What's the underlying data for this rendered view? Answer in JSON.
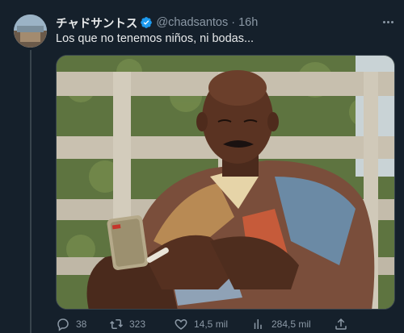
{
  "author": {
    "display_name": "チャドサントス",
    "handle": "@chadsantos",
    "separator": "·",
    "time": "16h",
    "verified": true
  },
  "tweet": {
    "text": "Los que no tenemos niños, ni bodas..."
  },
  "actions": {
    "replies": "38",
    "retweets": "323",
    "likes": "14,5 mil",
    "views": "284,5 mil"
  },
  "icons": {
    "avatar": "user-avatar",
    "verified": "verified-badge-icon",
    "more": "more-options-icon",
    "reply": "reply-icon",
    "retweet": "retweet-icon",
    "like": "heart-icon",
    "views": "analytics-bars-icon",
    "share": "share-icon"
  },
  "colors": {
    "background": "#15202b",
    "text": "#e7e9ea",
    "muted": "#8b98a5",
    "verified": "#1d9bf0",
    "border": "#38444d"
  }
}
